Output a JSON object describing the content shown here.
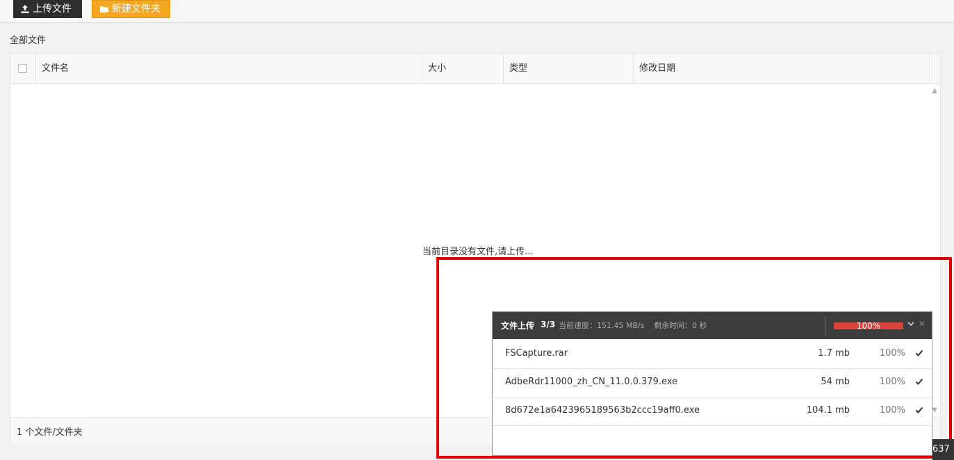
{
  "toolbar": {
    "upload_label": "上传文件",
    "new_folder_label": "新建文件夹",
    "upload_icon": "upload-icon",
    "folder_icon": "folder-icon"
  },
  "breadcrumb": "全部文件",
  "table": {
    "headers": {
      "name": "文件名",
      "size": "大小",
      "type": "类型",
      "date": "修改日期"
    },
    "empty_message": "当前目录没有文件,请上传...",
    "footer_count": "1 个文件/文件夹"
  },
  "upload_panel": {
    "title": "文件上传",
    "count": "3/3",
    "speed": "当前速度：151.45 MB/s",
    "remaining": "剩余时间：0 秒",
    "progress_percent": 100,
    "progress_text": "100%",
    "files": [
      {
        "name": "FSCapture.rar",
        "size": "1.7 mb",
        "percent": "100%"
      },
      {
        "name": "AdbeRdr11000_zh_CN_11.0.0.379.exe",
        "size": "54 mb",
        "percent": "100%"
      },
      {
        "name": "8d672e1a6423965189563b2ccc19aff0.exe",
        "size": "104.1 mb",
        "percent": "100%"
      }
    ]
  },
  "corner_badge": "637",
  "colors": {
    "upload_button": "#2d2d2d",
    "new_folder_button": "#f5a623",
    "highlight_border": "#e00000",
    "progress_bar": "#d9433c"
  }
}
